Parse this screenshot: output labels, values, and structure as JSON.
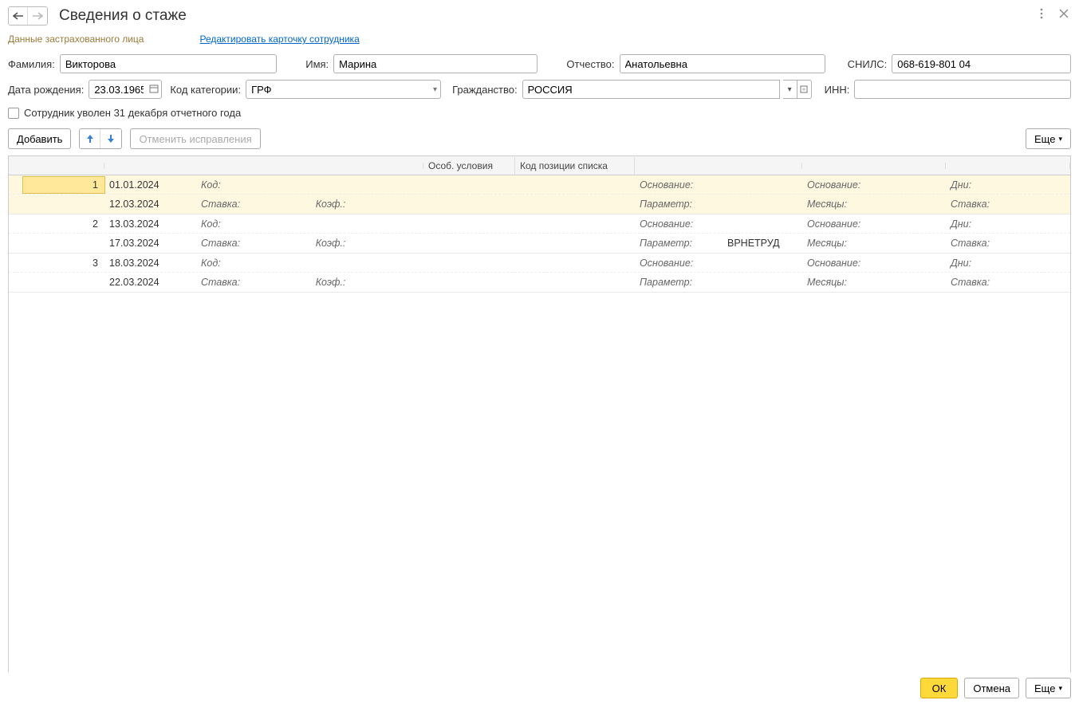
{
  "title": "Сведения о стаже",
  "subheader": {
    "insured": "Данные застрахованного лица",
    "edit_link": "Редактировать карточку сотрудника"
  },
  "labels": {
    "surname": "Фамилия:",
    "name": "Имя:",
    "patronymic": "Отчество:",
    "snils": "СНИЛС:",
    "birthdate": "Дата рождения:",
    "category": "Код категории:",
    "citizenship": "Гражданство:",
    "inn": "ИНН:",
    "dismissed": "Сотрудник уволен 31 декабря отчетного года",
    "add": "Добавить",
    "cancel_fix": "Отменить исправления",
    "more": "Еще",
    "ok": "ОК",
    "cancel": "Отмена"
  },
  "values": {
    "surname": "Викторова",
    "name": "Марина",
    "patronymic": "Анатольевна",
    "snils": "068-619-801 04",
    "birthdate": "23.03.1965",
    "category": "ГРФ",
    "citizenship": "РОССИЯ",
    "inn": ""
  },
  "columns": {
    "c3": "Особ. условия",
    "c4": "Код позиции списка"
  },
  "row_labels": {
    "kod": "Код:",
    "stavka": "Ставка:",
    "koef": "Коэф.:",
    "osnovanie": "Основание:",
    "parametr": "Параметр:",
    "mesyacy": "Месяцы:",
    "dni": "Дни:",
    "stavka2": "Ставка:"
  },
  "rows": [
    {
      "num": "1",
      "date1": "01.01.2024",
      "date2": "12.03.2024",
      "param_val": ""
    },
    {
      "num": "2",
      "date1": "13.03.2024",
      "date2": "17.03.2024",
      "param_val": "ВРНЕТРУД"
    },
    {
      "num": "3",
      "date1": "18.03.2024",
      "date2": "22.03.2024",
      "param_val": ""
    }
  ]
}
